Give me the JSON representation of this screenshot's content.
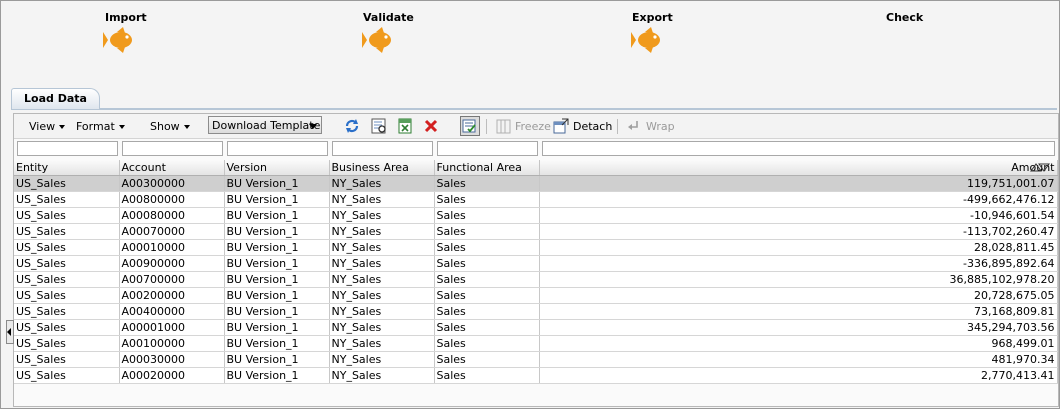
{
  "workflow": {
    "steps": [
      {
        "label": "Import",
        "status_icon": "fish-icon"
      },
      {
        "label": "Validate",
        "status_icon": "fish-icon"
      },
      {
        "label": "Export",
        "status_icon": "fish-icon"
      },
      {
        "label": "Check",
        "status_icon": ""
      }
    ],
    "fish_color": "#f09a1c"
  },
  "tab": {
    "label": "Load Data"
  },
  "toolbar": {
    "view_label": "View",
    "format_label": "Format",
    "show_label": "Show",
    "template_select_value": "Download Template",
    "freeze_label": "Freeze",
    "detach_label": "Detach",
    "wrap_label": "Wrap"
  },
  "grid": {
    "columns": [
      "Entity",
      "Account",
      "Version",
      "Business Area",
      "Functional Area",
      "Amount"
    ],
    "rows": [
      [
        "US_Sales",
        "A00300000",
        "BU Version_1",
        "NY_Sales",
        "Sales",
        "119,751,001.07"
      ],
      [
        "US_Sales",
        "A00800000",
        "BU Version_1",
        "NY_Sales",
        "Sales",
        "-499,662,476.12"
      ],
      [
        "US_Sales",
        "A00080000",
        "BU Version_1",
        "NY_Sales",
        "Sales",
        "-10,946,601.54"
      ],
      [
        "US_Sales",
        "A00070000",
        "BU Version_1",
        "NY_Sales",
        "Sales",
        "-113,702,260.47"
      ],
      [
        "US_Sales",
        "A00010000",
        "BU Version_1",
        "NY_Sales",
        "Sales",
        "28,028,811.45"
      ],
      [
        "US_Sales",
        "A00900000",
        "BU Version_1",
        "NY_Sales",
        "Sales",
        "-336,895,892.64"
      ],
      [
        "US_Sales",
        "A00700000",
        "BU Version_1",
        "NY_Sales",
        "Sales",
        "36,885,102,978.20"
      ],
      [
        "US_Sales",
        "A00200000",
        "BU Version_1",
        "NY_Sales",
        "Sales",
        "20,728,675.05"
      ],
      [
        "US_Sales",
        "A00400000",
        "BU Version_1",
        "NY_Sales",
        "Sales",
        "73,168,809.81"
      ],
      [
        "US_Sales",
        "A00001000",
        "BU Version_1",
        "NY_Sales",
        "Sales",
        "345,294,703.56"
      ],
      [
        "US_Sales",
        "A00100000",
        "BU Version_1",
        "NY_Sales",
        "Sales",
        "968,499.01"
      ],
      [
        "US_Sales",
        "A00030000",
        "BU Version_1",
        "NY_Sales",
        "Sales",
        "481,970.34"
      ],
      [
        "US_Sales",
        "A00020000",
        "BU Version_1",
        "NY_Sales",
        "Sales",
        "2,770,413.41"
      ]
    ],
    "selected_row": 0
  }
}
